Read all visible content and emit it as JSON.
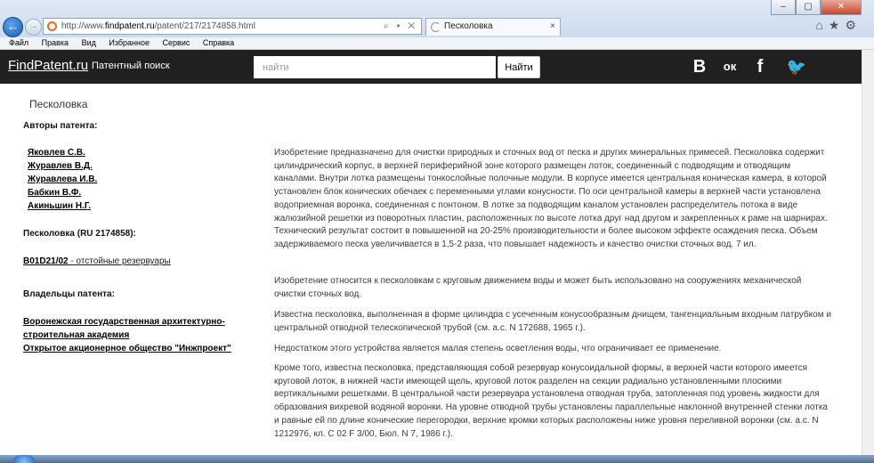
{
  "browser": {
    "url_prefix": "http://www.",
    "url_domain": "findpatent.ru",
    "url_path": "/patent/217/2174858.html",
    "address_tools": "⌕ ▾ ✕",
    "tab_title": "Песколовка",
    "tab_close": "×",
    "back_glyph": "←",
    "forward_glyph": "→",
    "window_buttons": [
      "–",
      "▢",
      "✕"
    ],
    "toolbar_icons": [
      "home-icon",
      "star-icon",
      "gear-icon"
    ],
    "toolbar_glyphs": [
      "⌂",
      "★",
      "⚙"
    ]
  },
  "menubar": {
    "items": [
      "Файл",
      "Правка",
      "Вид",
      "Избранное",
      "Сервис",
      "Справка"
    ]
  },
  "site": {
    "logo": "FindPatent.ru",
    "subtitle": "Патентный поиск",
    "search_placeholder": "найти",
    "search_button": "Найти",
    "social": [
      {
        "name": "vk-icon",
        "glyph": "В"
      },
      {
        "name": "odnoklassniki-icon",
        "glyph": "ок"
      },
      {
        "name": "facebook-icon",
        "glyph": "f"
      },
      {
        "name": "twitter-icon",
        "glyph": "🐦"
      }
    ]
  },
  "page": {
    "title": "Песколовка",
    "authors_label": "Авторы патента:",
    "authors": [
      "Яковлев С.В.",
      "Журавлев В.Д.",
      "Журавлева И.В.",
      "Бабкин В.Ф.",
      "Акиньшин Н.Г."
    ],
    "patent_label": "Песколовка (RU 2174858):",
    "ipc_code": "B01D21/02",
    "ipc_desc": " - отстойные резервуары",
    "owners_label": "Владельцы патента:",
    "owners": [
      "Воронежская государственная архитектурно-",
      "строительная академия",
      "Открытое акционерное общество \"Инжпроект\""
    ],
    "paragraphs": [
      "Изобретение предназначено для очистки природных и сточных вод от песка и других минеральных примесей. Песколовка содержит цилиндрический корпус, в верхней периферийной зоне которого размещен лоток, соединенный с подводящим и отводящим каналами. Внутри лотка размещены тонкослойные полочные модули. В корпусе имеется центральная коническая камера, в которой установлен блок конических обечаек с переменными углами конусности. По оси центральной камеры в верхней части установлена водоприемная воронка, соединенная с понтоном. В лотке за подводящим каналом установлен распределитель потока в виде жалюзийной решетки из поворотных пластин, расположенных по высоте лотка друг над другом и закрепленных к раме на шарнирах. Технический результат состоит в повышенной на 20-25% производительности и более высоком эффекте осаждения песка. Объем задерживаемого песка увеличивается в 1,5-2 раза, что повышает надежность и качество очистки сточных вод. 7 ил.",
      "Изобретение относится к песколовкам с круговым движением воды и может быть использовано на сооружениях механической очистки сточных вод.",
      "Известна песколовка, выполненная в форме цилиндра с усеченным конусообразным днищем, тангенциальным входным патрубком и центральной отводной телескопической трубой (см. а.с. N 172688, 1965 г.).",
      "Недостатком этого устройства является малая степень осветления воды, что ограничивает ее применение.",
      "Кроме того, известна песколовка, представляющая собой резервуар конусоидальной формы, в верхней части которого имеется круговой лоток, в нижней части имеющей щель, круговой лоток разделен на секции радиально установленными плоскими вертикальными решетками. В центральной части резервуара установлена отводная труба, затопленная под уровень жидкости для образования вихревой водяной воронки. На уровне отводной трубы установлены параллельные наклонной внутренней стенки лотка и равные ей по длине конические перегородки, верхние кромки которых расположены ниже уровня переливной воронки (см. а.с. N 1212976, кл. C 02 F 3/00, Бюл. N 7, 1986 г.)."
    ]
  }
}
